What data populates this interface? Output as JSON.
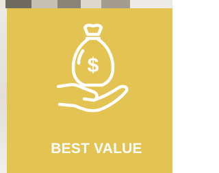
{
  "tile": {
    "background_color": "#e3c351",
    "foreground_color": "#ffffff",
    "icon": "money-bag-in-hand-icon",
    "icon_symbol": "$",
    "title": "BEST VALUE"
  }
}
